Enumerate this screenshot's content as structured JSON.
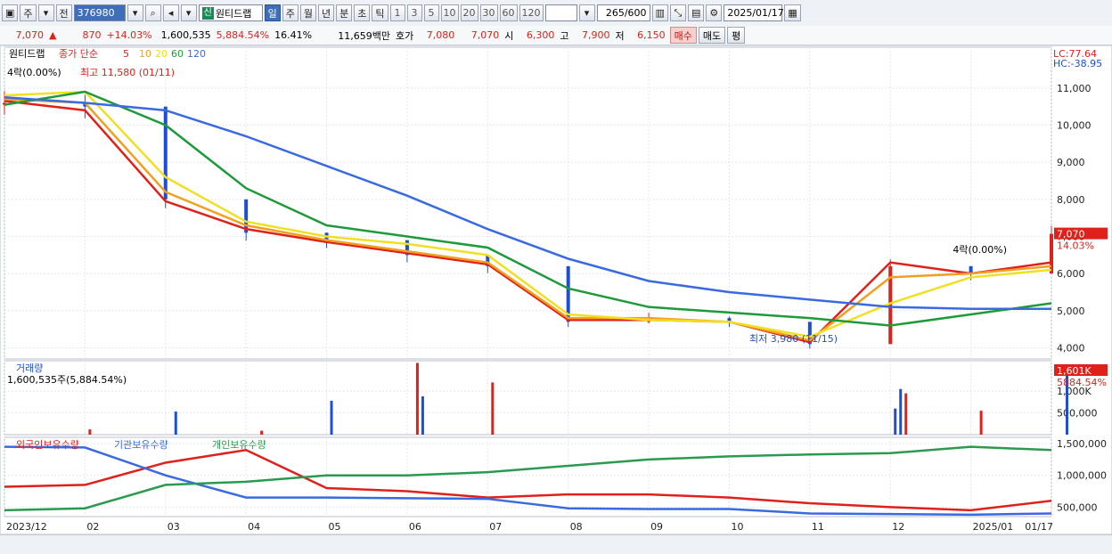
{
  "toolbar": {
    "type_label": "주",
    "prev_label": "전",
    "code": "376980",
    "sin_badge": "신",
    "stock_name": "원티드랩",
    "periods": [
      "일",
      "주",
      "월",
      "년",
      "분",
      "초",
      "틱"
    ],
    "selected_period": "일",
    "minute_options": [
      "1",
      "3",
      "5",
      "10",
      "20",
      "30",
      "60",
      "120"
    ],
    "count": "265",
    "count_total": "/600",
    "date": "2025/01/17"
  },
  "quote": {
    "price": "7,070",
    "arrow": "▲",
    "change": "870",
    "change_pct": "+14.03%",
    "volume": "1,600,535",
    "volume_pct": "5,884.54%",
    "turnover": "16.41%",
    "amount": "11,659백만",
    "hoga_label": "호가",
    "hoga_ask": "7,080",
    "hoga_bid": "7,070",
    "open_label": "시",
    "open": "6,300",
    "high_label": "고",
    "high": "7,900",
    "low_label": "저",
    "low": "6,150",
    "buy_label": "매수",
    "sell_label": "매도",
    "eval_label": "평"
  },
  "colors": {
    "up": "#e0201a",
    "down": "#1d4fd0",
    "ma5": "#e0201a",
    "ma10": "#f0a020",
    "ma20": "#f0e020",
    "ma60": "#1e9a3a",
    "ma120": "#3a6ae0",
    "foreign": "#e0201a",
    "institution": "#3a6ae0",
    "individual": "#2a9a50"
  },
  "chart_data": [
    {
      "type": "line",
      "title": "원티드랩",
      "legend_prefix": "종가 단순",
      "legend_periods": [
        "5",
        "10",
        "20",
        "60",
        "120"
      ],
      "ylim": [
        3700,
        12100
      ],
      "y_ticks": [
        4000,
        5000,
        6000,
        7000,
        8000,
        9000,
        10000,
        11000
      ],
      "y_tick_labels": [
        "4,000",
        "5,000",
        "6,000",
        "7,000",
        "8,000",
        "9,000",
        "10,000",
        "11,000"
      ],
      "x_labels": [
        "2023/12",
        "02",
        "03",
        "04",
        "05",
        "06",
        "07",
        "08",
        "09",
        "10",
        "11",
        "12",
        "2025/01",
        "01/17"
      ],
      "x": [
        "2023/12",
        "02",
        "03",
        "04",
        "05",
        "06",
        "07",
        "08",
        "09",
        "10",
        "11",
        "12",
        "2025/01",
        "01/17"
      ],
      "price_close": [
        10600,
        10500,
        8000,
        7100,
        6900,
        6500,
        6200,
        4700,
        4800,
        4700,
        4100,
        6200,
        6000,
        7070
      ],
      "series": [
        {
          "name": "5",
          "values": [
            10650,
            10400,
            7950,
            7200,
            6850,
            6550,
            6250,
            4750,
            4750,
            4700,
            4150,
            6300,
            6000,
            6300
          ]
        },
        {
          "name": "10",
          "values": [
            10700,
            10600,
            8200,
            7300,
            6900,
            6600,
            6300,
            4800,
            4800,
            4700,
            4200,
            5900,
            6000,
            6200
          ]
        },
        {
          "name": "20",
          "values": [
            10800,
            10900,
            8600,
            7400,
            7000,
            6800,
            6500,
            4900,
            4750,
            4700,
            4300,
            5200,
            5900,
            6100
          ]
        },
        {
          "name": "60",
          "values": [
            10550,
            10900,
            10000,
            8300,
            7300,
            7000,
            6700,
            5600,
            5100,
            4950,
            4800,
            4600,
            4900,
            5200
          ]
        },
        {
          "name": "120",
          "values": [
            10750,
            10600,
            10400,
            9700,
            8900,
            8100,
            7200,
            6400,
            5800,
            5500,
            5300,
            5100,
            5050,
            5050
          ]
        }
      ],
      "annotations": {
        "top_left": "4락(0.00%)",
        "high": "최고 11,580 (01/11)",
        "low": "최저 3,980 (11/15)",
        "right_mark": "4락(0.00%)"
      },
      "right_labels": {
        "lc": "LC:77.64",
        "hc": "HC:-38.95",
        "price": "7,070",
        "pct": "14.03%"
      }
    },
    {
      "type": "bar",
      "title": "거래량",
      "info": "1,600,535주(5,884.54%)",
      "ylim": [
        0,
        1700000
      ],
      "y_ticks": [
        500000,
        1000000
      ],
      "y_tick_labels": [
        "500,000",
        "1,000K"
      ],
      "right_labels": {
        "value": "1,601K",
        "pct": "5884.54%"
      },
      "spikes": [
        {
          "x": "02",
          "value": 120000
        },
        {
          "x": "03",
          "value": 530000
        },
        {
          "x": "04",
          "value": 90000
        },
        {
          "x": "05",
          "value": 780000
        },
        {
          "x": "06",
          "value": 1650000
        },
        {
          "x": "06",
          "value": 880000
        },
        {
          "x": "07",
          "value": 1200000
        },
        {
          "x": "12",
          "value": 1050000
        },
        {
          "x": "12",
          "value": 950000
        },
        {
          "x": "12",
          "value": 600000
        },
        {
          "x": "2025/01",
          "value": 550000
        },
        {
          "x": "01/17",
          "value": 1600535
        }
      ]
    },
    {
      "type": "line",
      "title": "외국인보유수량",
      "legend": [
        "외국인보유수량",
        "기관보유수량",
        "개인보유수량"
      ],
      "ylim": [
        350000,
        1600000
      ],
      "y_ticks": [
        500000,
        1000000,
        1500000
      ],
      "y_tick_labels": [
        "500,000",
        "1,000,000",
        "1,500,000"
      ],
      "x": [
        "2023/12",
        "02",
        "03",
        "04",
        "05",
        "06",
        "07",
        "08",
        "09",
        "10",
        "11",
        "12",
        "2025/01",
        "01/17"
      ],
      "series": [
        {
          "name": "외국인보유수량",
          "values": [
            820000,
            850000,
            1200000,
            1400000,
            800000,
            750000,
            650000,
            700000,
            700000,
            650000,
            560000,
            500000,
            450000,
            600000
          ]
        },
        {
          "name": "기관보유수량",
          "values": [
            1450000,
            1440000,
            1000000,
            650000,
            650000,
            640000,
            630000,
            480000,
            470000,
            470000,
            400000,
            390000,
            380000,
            400000
          ]
        },
        {
          "name": "개인보유수량",
          "values": [
            450000,
            480000,
            850000,
            900000,
            1000000,
            1000000,
            1050000,
            1150000,
            1250000,
            1300000,
            1330000,
            1350000,
            1450000,
            1400000
          ]
        }
      ]
    }
  ]
}
